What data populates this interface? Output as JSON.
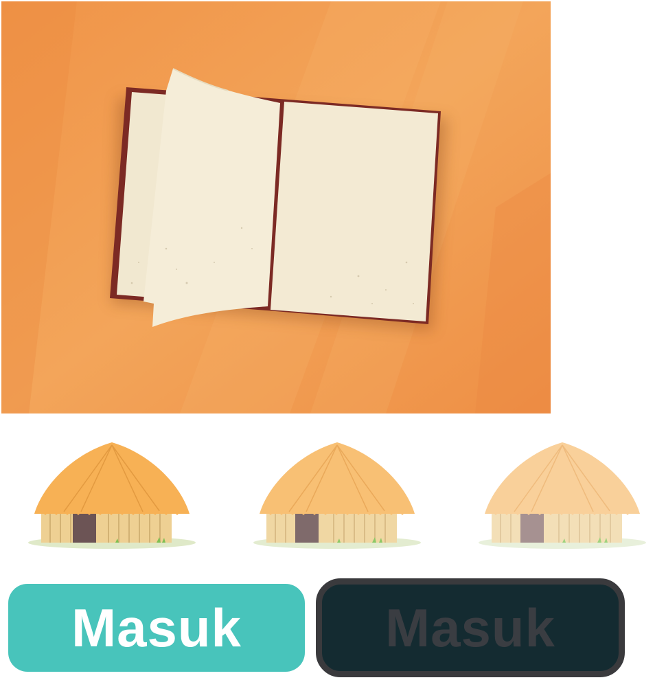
{
  "scene": {
    "name": "open-book-illustration",
    "background_color": "#f1994f",
    "page_color": "#f3ead3",
    "cover_color": "#7c2a24"
  },
  "huts": [
    {
      "name": "hut-1",
      "roof_color": "#f7b155",
      "wall_color": "#eed093",
      "door_color": "#6c5455"
    },
    {
      "name": "hut-2",
      "roof_color": "#f8c074",
      "wall_color": "#f0d7a3",
      "door_color": "#7f6a6b"
    },
    {
      "name": "hut-3",
      "roof_color": "#f9d09a",
      "wall_color": "#f3dfb7",
      "door_color": "#a69191"
    }
  ],
  "buttons": {
    "enter_active_label": "Masuk",
    "enter_disabled_label": "Masuk"
  },
  "colors": {
    "button_active": "#48c4bb",
    "button_disabled_bg": "#142b31",
    "button_disabled_border": "#3a3a3d"
  }
}
